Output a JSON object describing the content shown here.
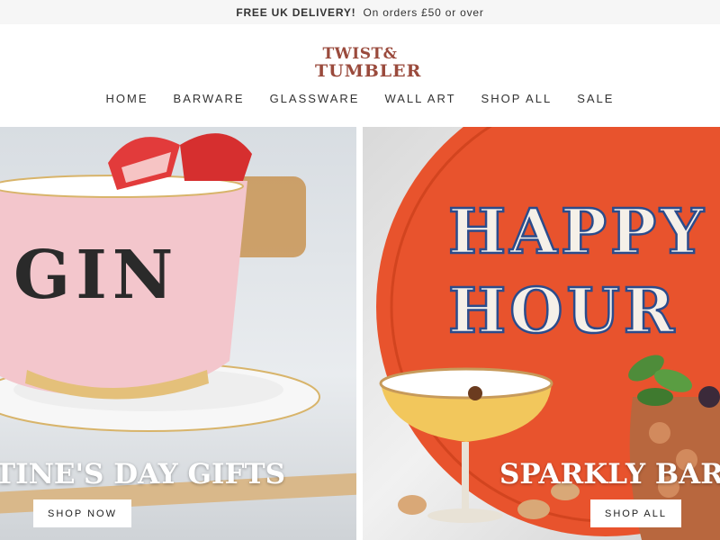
{
  "announcement": {
    "strong": "FREE UK DELIVERY!",
    "text": "On orders £50 or over"
  },
  "logo": {
    "line1": "TWIST&",
    "line2": "TUMBLER"
  },
  "nav": [
    "HOME",
    "BARWARE",
    "GLASSWARE",
    "WALL ART",
    "SHOP ALL",
    "SALE"
  ],
  "hero": {
    "left": {
      "cup_text": "GIN",
      "caption": "TINE'S DAY GIFTS",
      "button": "SHOP NOW"
    },
    "right": {
      "tray_line1": "HAPPY",
      "tray_line2": "HOUR",
      "caption": "SPARKLY BARWA",
      "button": "SHOP ALL"
    }
  },
  "colors": {
    "logo": "#9a4a3c",
    "tray": "#e8532d",
    "cup": "#f3c6cc"
  }
}
